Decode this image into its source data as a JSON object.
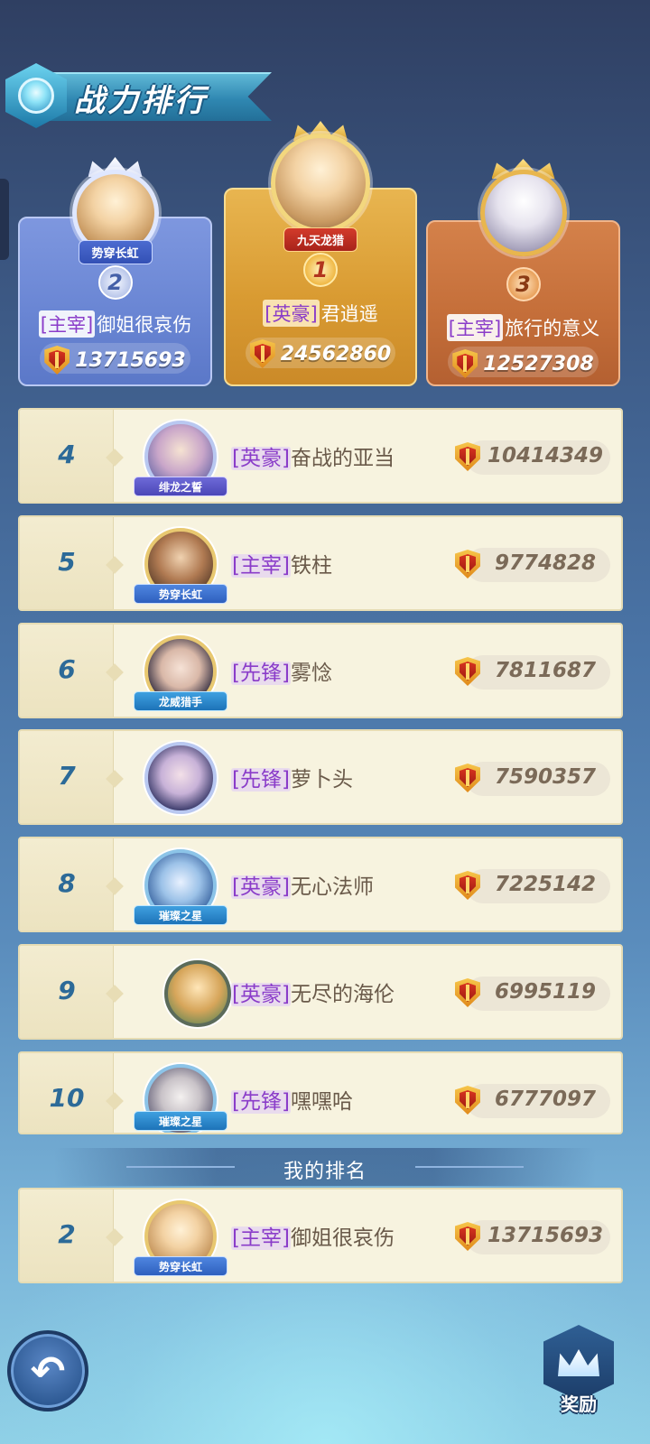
{
  "header": {
    "title": "战力排行"
  },
  "podium": [
    {
      "rank": "2",
      "title_badge": "势穿长虹",
      "role": "主宰",
      "name": "御姐很哀伤",
      "power": "13715693"
    },
    {
      "rank": "1",
      "title_badge": "九天龙猎",
      "role": "英豪",
      "name": "君逍遥",
      "power": "24562860"
    },
    {
      "rank": "3",
      "title_badge": "",
      "role": "主宰",
      "name": "旅行的意义",
      "power": "12527308"
    }
  ],
  "list": [
    {
      "rank": "4",
      "badge": "绯龙之誓",
      "role": "英豪",
      "name": "奋战的亚当",
      "power": "10414349"
    },
    {
      "rank": "5",
      "badge": "势穿长虹",
      "role": "主宰",
      "name": "铁柱",
      "power": "9774828"
    },
    {
      "rank": "6",
      "badge": "龙威猎手",
      "role": "先锋",
      "name": "雾惗",
      "power": "7811687"
    },
    {
      "rank": "7",
      "badge": "",
      "role": "先锋",
      "name": "萝卜头",
      "power": "7590357"
    },
    {
      "rank": "8",
      "badge": "璀璨之星",
      "role": "英豪",
      "name": "无心法师",
      "power": "7225142"
    },
    {
      "rank": "9",
      "badge": "",
      "role": "英豪",
      "name": "无尽的海伦",
      "power": "6995119"
    },
    {
      "rank": "10",
      "badge": "璀璨之星",
      "role": "先锋",
      "name": "嘿嘿哈",
      "power": "6777097"
    }
  ],
  "my_rank": {
    "label": "我的排名",
    "rank": "2",
    "badge": "势穿长虹",
    "role": "主宰",
    "name": "御姐很哀伤",
    "power": "13715693"
  },
  "buttons": {
    "back_icon": "undo-arrow-icon",
    "reward_label": "奖励"
  },
  "colors": {
    "gold": "#d99b32",
    "silver_blue": "#6a86d4",
    "bronze": "#c56f3a",
    "role_purple": "#8a3cc9",
    "rank_blue": "#2c6a98"
  }
}
